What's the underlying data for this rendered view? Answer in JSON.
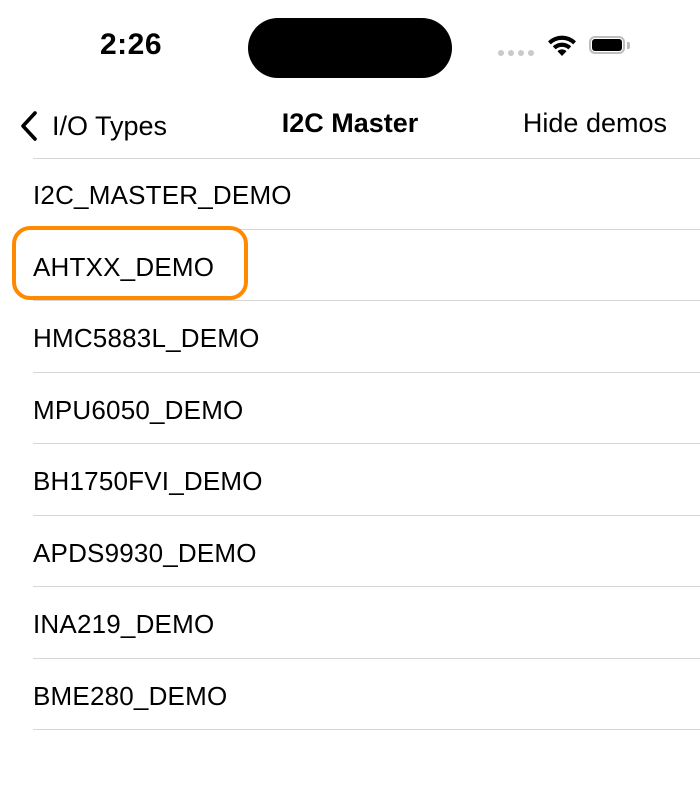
{
  "status_bar": {
    "time": "2:26",
    "icons": [
      "cellular-signal-icon",
      "wifi-icon",
      "battery-icon"
    ]
  },
  "nav": {
    "back_label": "I/O Types",
    "title": "I2C Master",
    "right_button_label": "Hide demos"
  },
  "list": {
    "items": [
      {
        "label": "I2C_MASTER_DEMO"
      },
      {
        "label": "AHTXX_DEMO",
        "highlighted": true
      },
      {
        "label": "HMC5883L_DEMO"
      },
      {
        "label": "MPU6050_DEMO"
      },
      {
        "label": "BH1750FVI_DEMO"
      },
      {
        "label": "APDS9930_DEMO"
      },
      {
        "label": "INA219_DEMO"
      },
      {
        "label": "BME280_DEMO"
      }
    ]
  },
  "colors": {
    "highlight": "#ff8a00",
    "divider": "#d6d6d6",
    "text": "#000000",
    "background": "#ffffff"
  }
}
